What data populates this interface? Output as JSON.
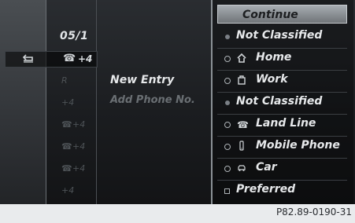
{
  "date": "05/1",
  "back_row_number": "+4",
  "faded_list": [
    "R",
    "+4",
    "+4",
    "+4",
    "+4",
    "+4"
  ],
  "popup_menu": {
    "new_entry": "New Entry",
    "add_phone_no": "Add Phone No."
  },
  "continue": "Continue",
  "list": [
    {
      "label": "Not Classified",
      "kind": "bullet",
      "icon": ""
    },
    {
      "label": "Home",
      "kind": "radio",
      "icon": "home-icon"
    },
    {
      "label": "Work",
      "kind": "radio",
      "icon": "work-icon"
    },
    {
      "label": "Not Classified",
      "kind": "bullet",
      "icon": ""
    },
    {
      "label": "Land Line",
      "kind": "radio",
      "icon": "landline-icon"
    },
    {
      "label": "Mobile Phone",
      "kind": "radio",
      "icon": "mobile-icon"
    },
    {
      "label": "Car",
      "kind": "radio",
      "icon": "car-icon"
    },
    {
      "label": "Preferred",
      "kind": "checkbox",
      "icon": ""
    }
  ],
  "footer_code": "P82.89-0190-31"
}
